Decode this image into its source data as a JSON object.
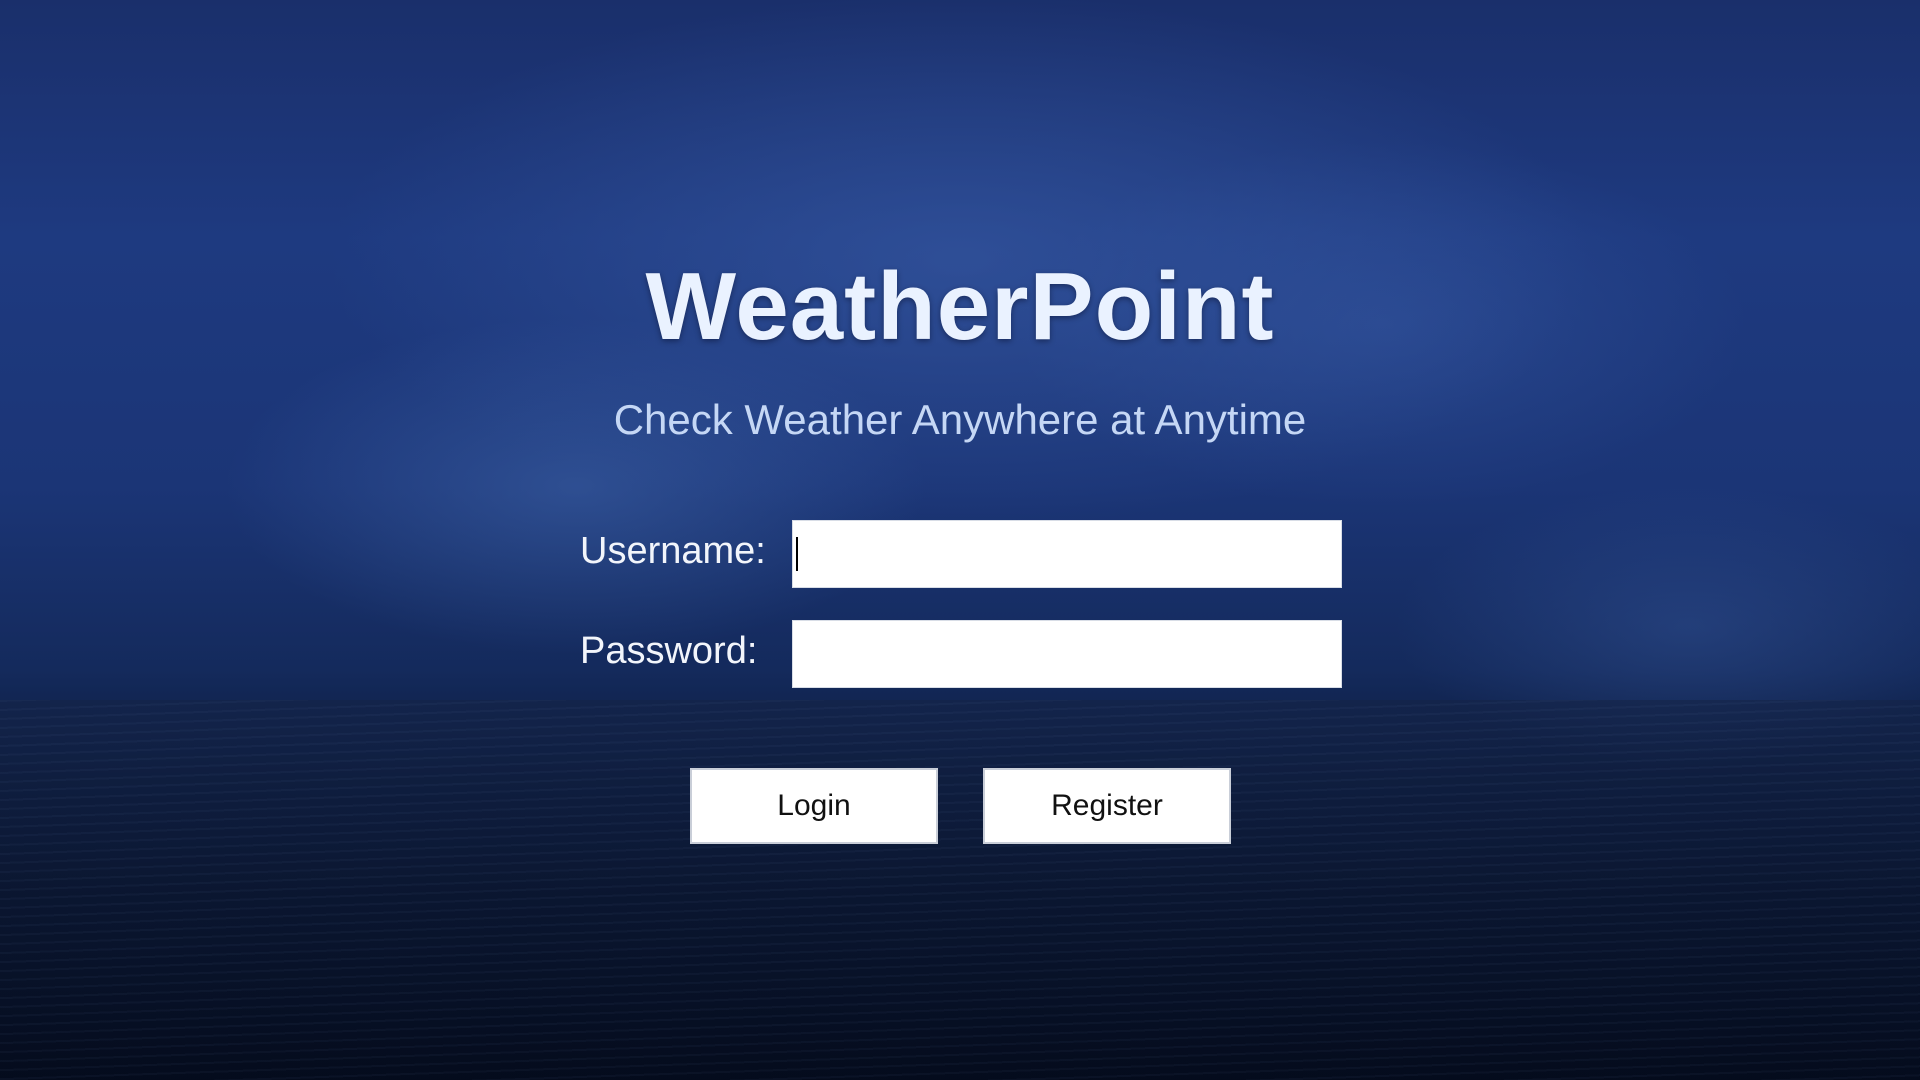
{
  "app": {
    "title": "WeatherPoint",
    "subtitle": "Check Weather Anywhere at Anytime"
  },
  "form": {
    "username_label": "Username:",
    "username_value": "",
    "password_label": "Password:",
    "password_value": ""
  },
  "buttons": {
    "login": "Login",
    "register": "Register"
  },
  "theme": {
    "background": "#1b3576",
    "title_color": "#eaf2ff",
    "subtitle_color": "#c5d7f5"
  }
}
